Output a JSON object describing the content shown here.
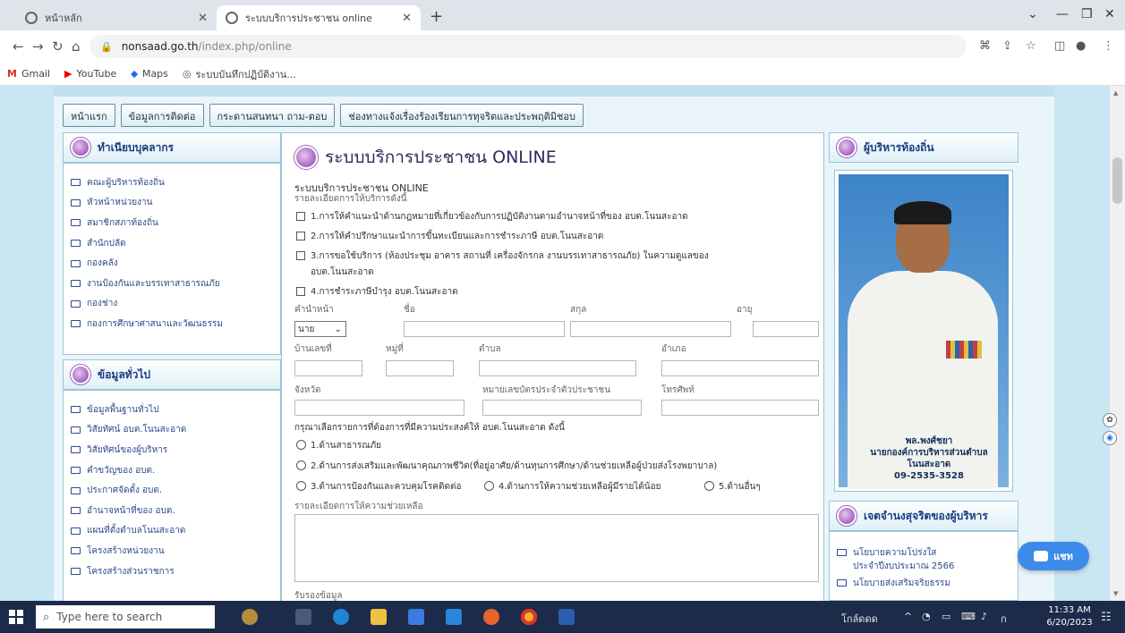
{
  "browser": {
    "tabs": [
      {
        "title": "หน้าหลัก"
      },
      {
        "title": "ระบบบริการประชาชน online"
      }
    ],
    "url_host": "nonsaad.go.th",
    "url_path": "/index.php/online",
    "bookmarks": [
      "Gmail",
      "YouTube",
      "Maps",
      "ระบบบันทึกปฏิบัติงาน..."
    ]
  },
  "menu": [
    "หน้าแรก",
    "ข้อมูลการติดต่อ",
    "กระดานสนทนา ถาม-ตอบ",
    "ช่องทางแจ้งเรื่องร้องเรียนการทุจริตและประพฤติมิชอบ"
  ],
  "left_panel_1": {
    "title": "ทำเนียบบุคลากร",
    "items": [
      "คณะผู้บริหารท้องถิ่น",
      "หัวหน้าหน่วยงาน",
      "สมาชิกสภาท้องถิ่น",
      "สำนักปลัด",
      "กองคลัง",
      "งานป้องกันและบรรเทาสาธารณภัย",
      "กองช่าง",
      "กองการศึกษาศาสนาและวัฒนธรรม"
    ]
  },
  "left_panel_2": {
    "title": "ข้อมูลทั่วไป",
    "items": [
      "ข้อมูลพื้นฐานทั่วไป",
      "วิสัยทัศน์ อบต.โนนสะอาด",
      "วิสัยทัศน์ของผู้บริหาร",
      "คำขวัญของ อบต.",
      "ประกาศจัดตั้ง อบต.",
      "อำนาจหน้าที่ของ อบต.",
      "แผนที่ตั้งตำบลโนนสะอาด",
      "โครงสร้างหน่วยงาน",
      "โครงสร้างส่วนราชการ"
    ]
  },
  "main": {
    "title": "ระบบบริการประชาชน ONLINE",
    "heading": "ระบบบริการประชาชน ONLINE",
    "subheading": "รายละเอียดการให้บริการดังนี้",
    "services": [
      "1.การให้คำแนะนำด้านกฎหมายที่เกี่ยวข้องกับการปฏิบัติงานตามอำนาจหน้าที่ของ อบต.โนนสะอาด",
      "2.การให้คำปรึกษาแนะนำการขึ้นทะเบียนและการชำระภาษี อบต.โนนสะอาด",
      "3.การขอใช้บริการ (ห้องประชุม อาคาร สถานที่ เครื่องจักรกล งานบรรเทาสาธารณภัย) ในความดูแลของ",
      "อบต.โนนสะอาด",
      "4.การชำระภาษีบำรุง อบต.โนนสะอาด"
    ],
    "labels": {
      "prefix": "คำนำหน้า",
      "firstname": "ชื่อ",
      "lastname": "สกุล",
      "age": "อายุ",
      "house_no": "บ้านเลขที่",
      "moo": "หมู่ที่",
      "tambon": "ตำบล",
      "amphoe": "อำเภอ",
      "province": "จังหวัด",
      "id_card": "หมายเลขบัตรประจำตัวประชาชน",
      "phone": "โทรศัพท์",
      "choose_prompt": "กรุณาเลือกรายการที่ต้องการที่มีความประสงค์ให้ อบต.โนนสะอาด ดังนี้",
      "details": "รายละเอียดการให้ความช่วยเหลือ",
      "attach": "รับรองข้อมูล"
    },
    "prefix_value": "นาย",
    "options": [
      "1.ด้านสาธารณภัย",
      "2.ด้านการส่งเสริมและพัฒนาคุณภาพชีวิต(ที่อยู่อาศัย/ด้านทุนการศึกษา/ด้านช่วยเหลือผู้ป่วยส่งโรงพยาบาล)",
      "3.ด้านการป้องกันและควบคุมโรคติดต่อ",
      "4.ด้านการให้ความช่วยเหลือผู้มีรายได้น้อย",
      "5.ด้านอื่นๆ"
    ]
  },
  "right_panel_1": {
    "title": "ผู้บริหารท้องถิ่น",
    "caption": [
      "พล.พงศ์ชยา",
      "นายกองค์การบริหารส่วนตำบลโนนสะอาด",
      "09-2535-3528"
    ]
  },
  "right_panel_2": {
    "title": "เจตจำนงสุจริตของผู้บริหาร",
    "items": [
      "นโยบายความโปร่งใสประจำปีงบประมาณ 2566",
      "นโยบายส่งเสริมจริยธรรม"
    ]
  },
  "chat": {
    "label": "แชท"
  },
  "taskbar": {
    "search_placeholder": "Type here to search",
    "tray_label": "โกล์ดดด",
    "time": "11:33 AM",
    "date": "6/20/2023"
  }
}
